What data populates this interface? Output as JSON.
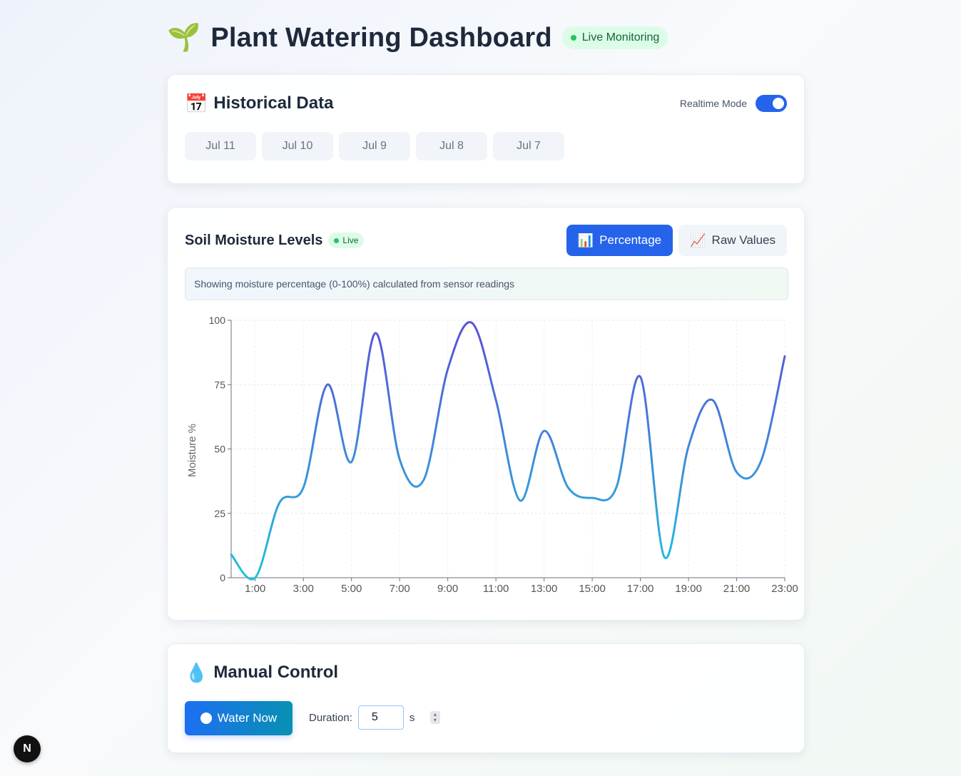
{
  "header": {
    "emoji": "🌱",
    "title": "Plant Watering Dashboard",
    "badge": "Live Monitoring"
  },
  "historical": {
    "emoji": "📅",
    "title": "Historical Data",
    "realtime_label": "Realtime Mode",
    "realtime_on": true,
    "dates": [
      "Jul 11",
      "Jul 10",
      "Jul 9",
      "Jul 8",
      "Jul 7"
    ]
  },
  "soil": {
    "title": "Soil Moisture Levels",
    "live_badge": "Live",
    "modes": [
      {
        "icon": "📊",
        "label": "Percentage",
        "active": true
      },
      {
        "icon": "📈",
        "label": "Raw Values",
        "active": false
      }
    ],
    "info": "Showing moisture percentage (0-100%) calculated from sensor readings"
  },
  "chart_data": {
    "type": "line",
    "ylabel": "Moisture %",
    "xlabel": "",
    "ylim": [
      0,
      100
    ],
    "yticks": [
      0,
      25,
      50,
      75,
      100
    ],
    "xticks": [
      "1:00",
      "3:00",
      "5:00",
      "7:00",
      "9:00",
      "11:00",
      "13:00",
      "15:00",
      "17:00",
      "19:00",
      "21:00",
      "23:00"
    ],
    "x": [
      0,
      1,
      2,
      3,
      4,
      5,
      6,
      7,
      8,
      9,
      10,
      11,
      12,
      13,
      14,
      15,
      16,
      17,
      18,
      19,
      20,
      21,
      22,
      23
    ],
    "values": [
      9,
      0,
      29,
      35,
      75,
      45,
      95,
      46,
      38,
      81,
      99,
      69,
      30,
      57,
      35,
      31,
      35,
      78,
      8,
      51,
      69,
      41,
      45,
      86
    ],
    "grid": true,
    "line_colors": [
      "#22c1dc",
      "#5b50d6"
    ]
  },
  "manual": {
    "emoji": "💧",
    "title": "Manual Control",
    "water_button": "Water Now",
    "duration_label": "Duration:",
    "duration_value": "5",
    "duration_unit": "s"
  },
  "dev_badge": "N"
}
